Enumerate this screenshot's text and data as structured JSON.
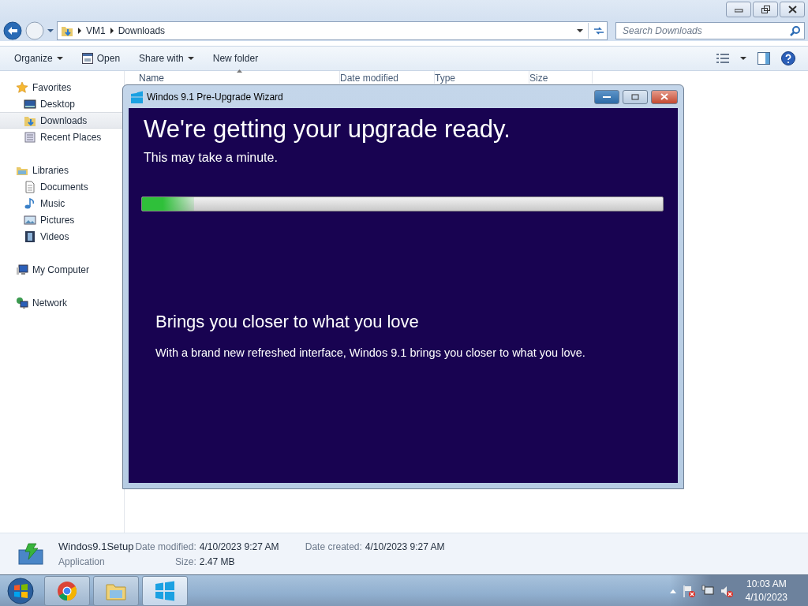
{
  "explorer": {
    "caption_buttons": [
      {
        "kind": "minimize"
      },
      {
        "kind": "restore"
      },
      {
        "kind": "close"
      }
    ],
    "breadcrumbs": [
      "VM1",
      "Downloads"
    ],
    "search": {
      "placeholder": "Search Downloads"
    },
    "toolbar": [
      {
        "label": "Organize",
        "kind": "menu"
      },
      {
        "label": "Open",
        "kind": "open"
      },
      {
        "label": "Share with",
        "kind": "menu"
      },
      {
        "label": "New folder",
        "kind": "plain"
      }
    ],
    "sidebar": {
      "items": [
        {
          "label": "Favorites",
          "kind": "star",
          "selected": false,
          "children": [
            {
              "label": "Desktop",
              "kind": "desktop",
              "selected": false
            },
            {
              "label": "Downloads",
              "kind": "downloads",
              "selected": true
            },
            {
              "label": "Recent Places",
              "kind": "recent",
              "selected": false
            }
          ]
        },
        {
          "label": "Libraries",
          "kind": "library",
          "selected": false,
          "children": [
            {
              "label": "Documents",
              "kind": "document",
              "selected": false
            },
            {
              "label": "Music",
              "kind": "music",
              "selected": false
            },
            {
              "label": "Pictures",
              "kind": "pictures",
              "selected": false
            },
            {
              "label": "Videos",
              "kind": "videos",
              "selected": false
            }
          ]
        },
        {
          "label": "My Computer",
          "kind": "computer",
          "selected": false
        },
        {
          "label": "Network",
          "kind": "network",
          "selected": false
        }
      ]
    },
    "table": {
      "columns": [
        {
          "label": "Name",
          "sorted": true
        },
        {
          "label": "Date modified",
          "sorted": false
        },
        {
          "label": "Type",
          "sorted": false
        },
        {
          "label": "Size",
          "sorted": false
        }
      ]
    },
    "details": {
      "name": "Windos9.1Setup",
      "type": "Application",
      "fields": [
        {
          "label": "Date modified:",
          "value": "4/10/2023 9:27 AM"
        },
        {
          "label": "Date created:",
          "value": "4/10/2023 9:27 AM"
        },
        {
          "label": "Size:",
          "value": "2.47 MB"
        }
      ]
    }
  },
  "wizard": {
    "title": "Windos 9.1 Pre-Upgrade Wizard",
    "heading": "We're getting your upgrade ready.",
    "subtitle": "This may take a minute.",
    "progress": {
      "level": 0.1
    },
    "feature_title": "Brings you closer to what you love",
    "feature_text": "With a brand new refreshed interface, Windos 9.1 brings you closer to what you love."
  },
  "taskbar": {
    "apps": [
      {
        "kind": "chrome"
      },
      {
        "kind": "folder"
      },
      {
        "kind": "windows"
      }
    ],
    "tray": {
      "time": "10:03 AM",
      "date": "4/10/2023"
    }
  }
}
